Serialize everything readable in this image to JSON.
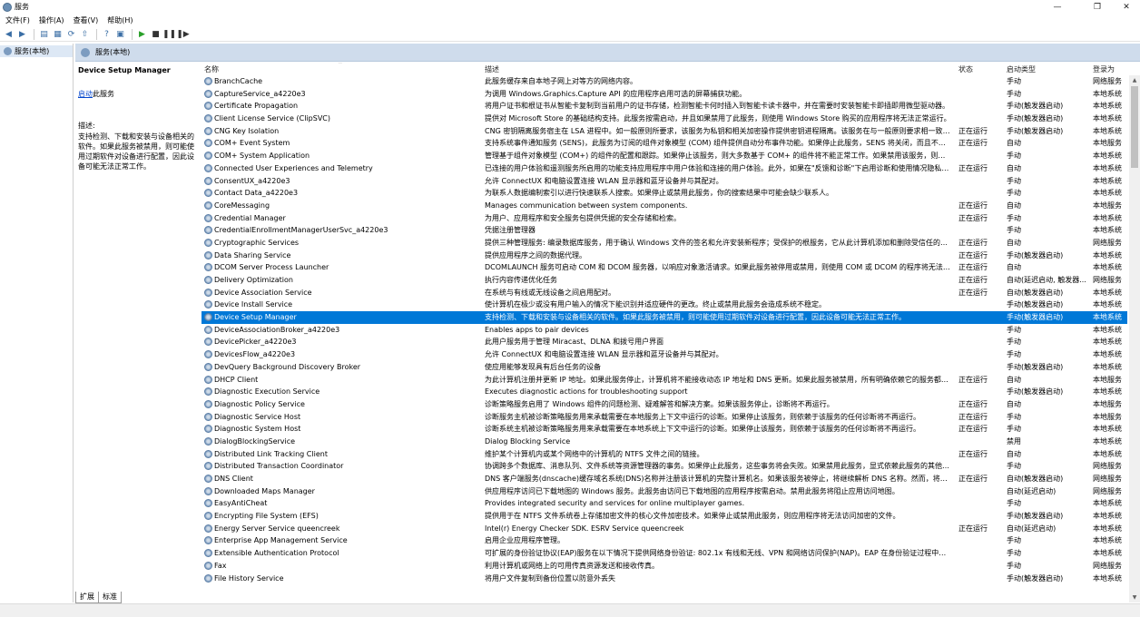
{
  "window": {
    "title": "服务"
  },
  "menu": [
    "文件(F)",
    "操作(A)",
    "查看(V)",
    "帮助(H)"
  ],
  "toolbar": {
    "icons": [
      "back-icon",
      "forward-icon",
      "show-hide-tree-icon",
      "properties-icon",
      "refresh-icon",
      "export-list-icon",
      "help-icon",
      "console-icon",
      "start-service-icon",
      "stop-service-icon",
      "pause-service-icon",
      "restart-service-icon"
    ]
  },
  "tree": {
    "root_label": "服务(本地)"
  },
  "pane": {
    "header": "服务(本地)"
  },
  "details": {
    "service_name": "Device Setup Manager",
    "start_link": "启动",
    "start_suffix": "此服务",
    "desc_label": "描述:",
    "description": "支持检测、下载和安装与设备相关的软件。如果此服务被禁用，则可能使用过期软件对设备进行配置，因此设备可能无法正常工作。"
  },
  "columns": {
    "name": "名称",
    "description": "描述",
    "status": "状态",
    "startup": "启动类型",
    "logon": "登录为"
  },
  "rows": [
    {
      "name": "BranchCache",
      "desc": "此服务缓存来自本地子网上对等方的网络内容。",
      "status": "",
      "startup": "手动",
      "logon": "网络服务"
    },
    {
      "name": "CaptureService_a4220e3",
      "desc": "为调用 Windows.Graphics.Capture API 的应用程序启用可选的屏幕捕获功能。",
      "status": "",
      "startup": "手动",
      "logon": "本地系统"
    },
    {
      "name": "Certificate Propagation",
      "desc": "将用户证书和根证书从智能卡复制到当前用户的证书存储，检测智能卡何时插入到智能卡读卡器中，并在需要时安装智能卡即插即用微型驱动器。",
      "status": "",
      "startup": "手动(触发器启动)",
      "logon": "本地系统"
    },
    {
      "name": "Client License Service (ClipSVC)",
      "desc": "提供对 Microsoft Store 的基础结构支持。此服务按需启动，并且如果禁用了此服务，则使用 Windows Store 购买的应用程序将无法正常运行。",
      "status": "",
      "startup": "手动(触发器启动)",
      "logon": "本地系统"
    },
    {
      "name": "CNG Key Isolation",
      "desc": "CNG 密钥隔离服务宿主在 LSA 进程中。如一般原则所要求，该服务为私钥和相关加密操作提供密钥进程隔离。该服务在与一般原则要求相一致的安...",
      "status": "正在运行",
      "startup": "手动(触发器启动)",
      "logon": "本地系统"
    },
    {
      "name": "COM+ Event System",
      "desc": "支持系统事件通知服务 (SENS)，此服务为订阅的组件对象模型 (COM) 组件提供自动分布事件功能。如果停止此服务，SENS 将关闭，而且不能提供...",
      "status": "正在运行",
      "startup": "自动",
      "logon": "本地服务"
    },
    {
      "name": "COM+ System Application",
      "desc": "管理基于组件对象模型 (COM+) 的组件的配置和跟踪。如果停止该服务，则大多数基于 COM+ 的组件将不能正常工作。如果禁用该服务，则任何...",
      "status": "",
      "startup": "手动",
      "logon": "本地系统"
    },
    {
      "name": "Connected User Experiences and Telemetry",
      "desc": "已连接的用户体验和遥测服务所启用的功能支持应用程序中用户体验和连接的用户体验。此外，如果在\"反馈和诊断\"下启用诊断和使用情况隐私选项...",
      "status": "正在运行",
      "startup": "自动",
      "logon": "本地系统"
    },
    {
      "name": "ConsentUX_a4220e3",
      "desc": "允许 ConnectUX 和电脑设置连接 WLAN 显示器和蓝牙设备并与其配对。",
      "status": "",
      "startup": "手动",
      "logon": "本地系统"
    },
    {
      "name": "Contact Data_a4220e3",
      "desc": "为联系人数据编制索引以进行快速联系人搜索。如果停止或禁用此服务，你的搜索结果中可能会缺少联系人。",
      "status": "",
      "startup": "手动",
      "logon": "本地系统"
    },
    {
      "name": "CoreMessaging",
      "desc": "Manages communication between system components.",
      "status": "正在运行",
      "startup": "自动",
      "logon": "本地服务"
    },
    {
      "name": "Credential Manager",
      "desc": "为用户、应用程序和安全服务包提供凭据的安全存储和检索。",
      "status": "正在运行",
      "startup": "手动",
      "logon": "本地系统"
    },
    {
      "name": "CredentialEnrollmentManagerUserSvc_a4220e3",
      "desc": "凭据注册管理器",
      "status": "",
      "startup": "手动",
      "logon": "本地系统"
    },
    {
      "name": "Cryptographic Services",
      "desc": "提供三种管理服务: 编录数据库服务，用于确认 Windows 文件的签名和允许安装新程序；受保护的根服务，它从此计算机添加和删除受信任的根证...",
      "status": "正在运行",
      "startup": "自动",
      "logon": "网络服务"
    },
    {
      "name": "Data Sharing Service",
      "desc": "提供应用程序之间的数据代理。",
      "status": "正在运行",
      "startup": "手动(触发器启动)",
      "logon": "本地系统"
    },
    {
      "name": "DCOM Server Process Launcher",
      "desc": "DCOMLAUNCH 服务可启动 COM 和 DCOM 服务器，以响应对象激活请求。如果此服务被停用或禁用，则使用 COM 或 DCOM 的程序将无法正常...",
      "status": "正在运行",
      "startup": "自动",
      "logon": "本地系统"
    },
    {
      "name": "Delivery Optimization",
      "desc": "执行内容传递优化任务",
      "status": "正在运行",
      "startup": "自动(延迟启动, 触发器...",
      "logon": "网络服务"
    },
    {
      "name": "Device Association Service",
      "desc": "在系统与有线或无线设备之间启用配对。",
      "status": "正在运行",
      "startup": "自动(触发器启动)",
      "logon": "本地系统"
    },
    {
      "name": "Device Install Service",
      "desc": "使计算机在极少或没有用户输入的情况下能识别并适应硬件的更改。终止或禁用此服务会造成系统不稳定。",
      "status": "",
      "startup": "手动(触发器启动)",
      "logon": "本地系统"
    },
    {
      "name": "Device Setup Manager",
      "desc": "支持检测、下载和安装与设备相关的软件。如果此服务被禁用，则可能使用过期软件对设备进行配置，因此设备可能无法正常工作。",
      "status": "",
      "startup": "手动(触发器启动)",
      "logon": "本地系统",
      "selected": true
    },
    {
      "name": "DeviceAssociationBroker_a4220e3",
      "desc": "Enables apps to pair devices",
      "status": "",
      "startup": "手动",
      "logon": "本地系统"
    },
    {
      "name": "DevicePicker_a4220e3",
      "desc": "此用户服务用于管理 Miracast、DLNA 和拨号用户界面",
      "status": "",
      "startup": "手动",
      "logon": "本地系统"
    },
    {
      "name": "DevicesFlow_a4220e3",
      "desc": "允许 ConnectUX 和电脑设置连接 WLAN 显示器和蓝牙设备并与其配对。",
      "status": "",
      "startup": "手动",
      "logon": "本地系统"
    },
    {
      "name": "DevQuery Background Discovery Broker",
      "desc": "使应用能够发现具有后台任务的设备",
      "status": "",
      "startup": "手动(触发器启动)",
      "logon": "本地系统"
    },
    {
      "name": "DHCP Client",
      "desc": "为此计算机注册并更新 IP 地址。如果此服务停止，计算机将不能接收动态 IP 地址和 DNS 更新。如果此服务被禁用，所有明确依赖它的服务都将不...",
      "status": "正在运行",
      "startup": "自动",
      "logon": "本地服务"
    },
    {
      "name": "Diagnostic Execution Service",
      "desc": "Executes diagnostic actions for troubleshooting support",
      "status": "",
      "startup": "手动(触发器启动)",
      "logon": "本地系统"
    },
    {
      "name": "Diagnostic Policy Service",
      "desc": "诊断策略服务启用了 Windows 组件的问题检测、疑难解答和解决方案。如果该服务停止，诊断将不再运行。",
      "status": "正在运行",
      "startup": "自动",
      "logon": "本地服务"
    },
    {
      "name": "Diagnostic Service Host",
      "desc": "诊断服务主机被诊断策略服务用来承载需要在本地服务上下文中运行的诊断。如果停止该服务，则依赖于该服务的任何诊断将不再运行。",
      "status": "正在运行",
      "startup": "手动",
      "logon": "本地服务"
    },
    {
      "name": "Diagnostic System Host",
      "desc": "诊断系统主机被诊断策略服务用来承载需要在本地系统上下文中运行的诊断。如果停止该服务，则依赖于该服务的任何诊断将不再运行。",
      "status": "正在运行",
      "startup": "手动",
      "logon": "本地系统"
    },
    {
      "name": "DialogBlockingService",
      "desc": "Dialog Blocking Service",
      "status": "",
      "startup": "禁用",
      "logon": "本地系统"
    },
    {
      "name": "Distributed Link Tracking Client",
      "desc": "维护某个计算机内或某个网络中的计算机的 NTFS 文件之间的链接。",
      "status": "正在运行",
      "startup": "自动",
      "logon": "本地系统"
    },
    {
      "name": "Distributed Transaction Coordinator",
      "desc": "协调跨多个数据库、消息队列、文件系统等资源管理器的事务。如果停止此服务，这些事务将会失败。如果禁用此服务，显式依赖此服务的其他服...",
      "status": "",
      "startup": "手动",
      "logon": "网络服务"
    },
    {
      "name": "DNS Client",
      "desc": "DNS 客户端服务(dnscache)缓存域名系统(DNS)名称并注册该计算机的完整计算机名。如果该服务被停止，将继续解析 DNS 名称。然而，将不缓...",
      "status": "正在运行",
      "startup": "自动(触发器启动)",
      "logon": "网络服务"
    },
    {
      "name": "Downloaded Maps Manager",
      "desc": "供应用程序访问已下载地图的 Windows 服务。此服务由访问已下载地图的应用程序按需启动。禁用此服务将阻止应用访问地图。",
      "status": "",
      "startup": "自动(延迟启动)",
      "logon": "网络服务"
    },
    {
      "name": "EasyAntiCheat",
      "desc": "Provides integrated security and services for online multiplayer games.",
      "status": "",
      "startup": "手动",
      "logon": "本地系统"
    },
    {
      "name": "Encrypting File System (EFS)",
      "desc": "提供用于在 NTFS 文件系统卷上存储加密文件的核心文件加密技术。如果停止或禁用此服务，则应用程序将无法访问加密的文件。",
      "status": "",
      "startup": "手动(触发器启动)",
      "logon": "本地系统"
    },
    {
      "name": "Energy Server Service queencreek",
      "desc": "Intel(r) Energy Checker SDK. ESRV Service queencreek",
      "status": "正在运行",
      "startup": "自动(延迟启动)",
      "logon": "本地系统"
    },
    {
      "name": "Enterprise App Management Service",
      "desc": "启用企业应用程序管理。",
      "status": "",
      "startup": "手动",
      "logon": "本地系统"
    },
    {
      "name": "Extensible Authentication Protocol",
      "desc": "可扩展的身份验证协议(EAP)服务在以下情况下提供网络身份验证: 802.1x 有线和无线、VPN 和网络访问保护(NAP)。EAP 在身份验证过程中也提供...",
      "status": "",
      "startup": "手动",
      "logon": "本地系统"
    },
    {
      "name": "Fax",
      "desc": "利用计算机或网络上的可用传真资源发送和接收传真。",
      "status": "",
      "startup": "手动",
      "logon": "网络服务"
    },
    {
      "name": "File History Service",
      "desc": "将用户文件复制到备份位置以防意外丢失",
      "status": "",
      "startup": "手动(触发器启动)",
      "logon": "本地系统"
    }
  ],
  "tabs": [
    "扩展",
    "标准"
  ]
}
